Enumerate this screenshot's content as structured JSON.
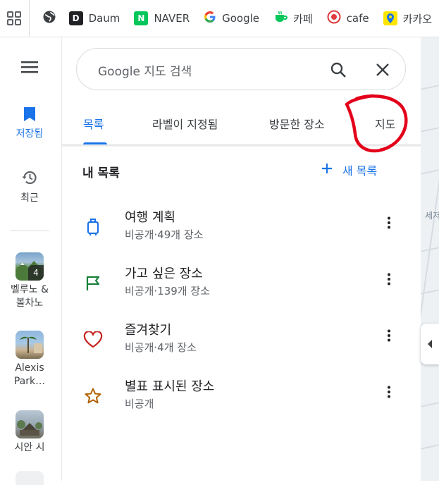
{
  "bookmarks": [
    {
      "label": "",
      "icon": "globe-icon"
    },
    {
      "label": "Daum",
      "icon": "daum-icon",
      "color": "#202124",
      "glyph": "D"
    },
    {
      "label": "NAVER",
      "icon": "naver-icon",
      "color": "#03c75a",
      "glyph": "N"
    },
    {
      "label": "Google",
      "icon": "google-icon"
    },
    {
      "label": "카페",
      "icon": "cafe-cup-icon"
    },
    {
      "label": "cafe",
      "icon": "cafe-badge-icon"
    },
    {
      "label": "카카오",
      "icon": "kakaomap-icon"
    }
  ],
  "rail": {
    "menu_icon": "hamburger-icon",
    "saved_label": "저장됨",
    "recent_label": "최근",
    "places": [
      {
        "label": "벨루노 & 볼차노",
        "badge": "4"
      },
      {
        "label": "Alexis Park…"
      },
      {
        "label": "시안 시"
      }
    ]
  },
  "search": {
    "placeholder": "Google 지도 검색"
  },
  "tabs": [
    "목록",
    "라벨이 지정됨",
    "방문한 장소",
    "지도"
  ],
  "section": {
    "title": "내 목록",
    "new_list": "새 목록"
  },
  "lists": [
    {
      "title": "여행 계획",
      "meta": "비공개·49개 장소",
      "icon": "suitcase-icon",
      "color": "#1a73e8"
    },
    {
      "title": "가고 싶은 장소",
      "meta": "비공개·139개 장소",
      "icon": "flag-icon",
      "color": "#188038"
    },
    {
      "title": "즐겨찾기",
      "meta": "비공개·4개 장소",
      "icon": "heart-icon",
      "color": "#c5221f"
    },
    {
      "title": "별표 표시된 장소",
      "meta": "비공개",
      "icon": "star-icon",
      "color": "#b06000"
    }
  ],
  "map": {
    "label": "세저"
  },
  "colors": {
    "accent": "#1a73e8",
    "annotation": "#e3001b"
  }
}
